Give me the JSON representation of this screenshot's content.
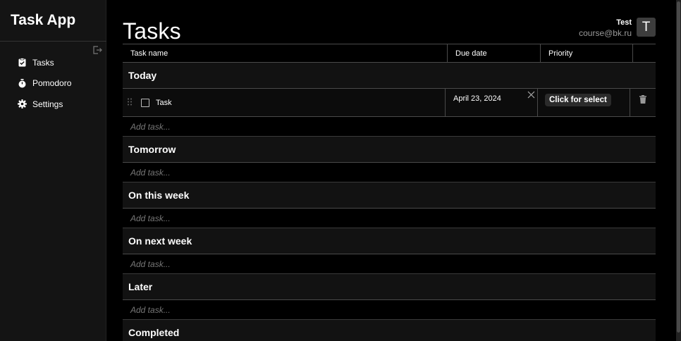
{
  "app": {
    "brand": "Task App"
  },
  "sidebar": {
    "items": [
      {
        "label": "Tasks",
        "icon": "clipboard-check-icon"
      },
      {
        "label": "Pomodoro",
        "icon": "stopwatch-icon"
      },
      {
        "label": "Settings",
        "icon": "gear-icon"
      }
    ]
  },
  "main": {
    "title": "Tasks"
  },
  "user": {
    "name": "Test",
    "email": "course@bk.ru",
    "initial": "T"
  },
  "table": {
    "columns": [
      "Task name",
      "Due date",
      "Priority"
    ],
    "add_placeholder": "Add task...",
    "groups": [
      {
        "title": "Today",
        "tasks": [
          {
            "name": "Task",
            "due": "April 23, 2024",
            "priority": "Click for select"
          }
        ]
      },
      {
        "title": "Tomorrow",
        "tasks": []
      },
      {
        "title": "On this week",
        "tasks": []
      },
      {
        "title": "On next week",
        "tasks": []
      },
      {
        "title": "Later",
        "tasks": []
      },
      {
        "title": "Completed",
        "tasks": []
      }
    ]
  },
  "colors": {
    "background": "#000000",
    "sidebar": "#141414",
    "group_header": "#121212",
    "border": "#4a4a4a",
    "badge": "#2b2b2b"
  }
}
